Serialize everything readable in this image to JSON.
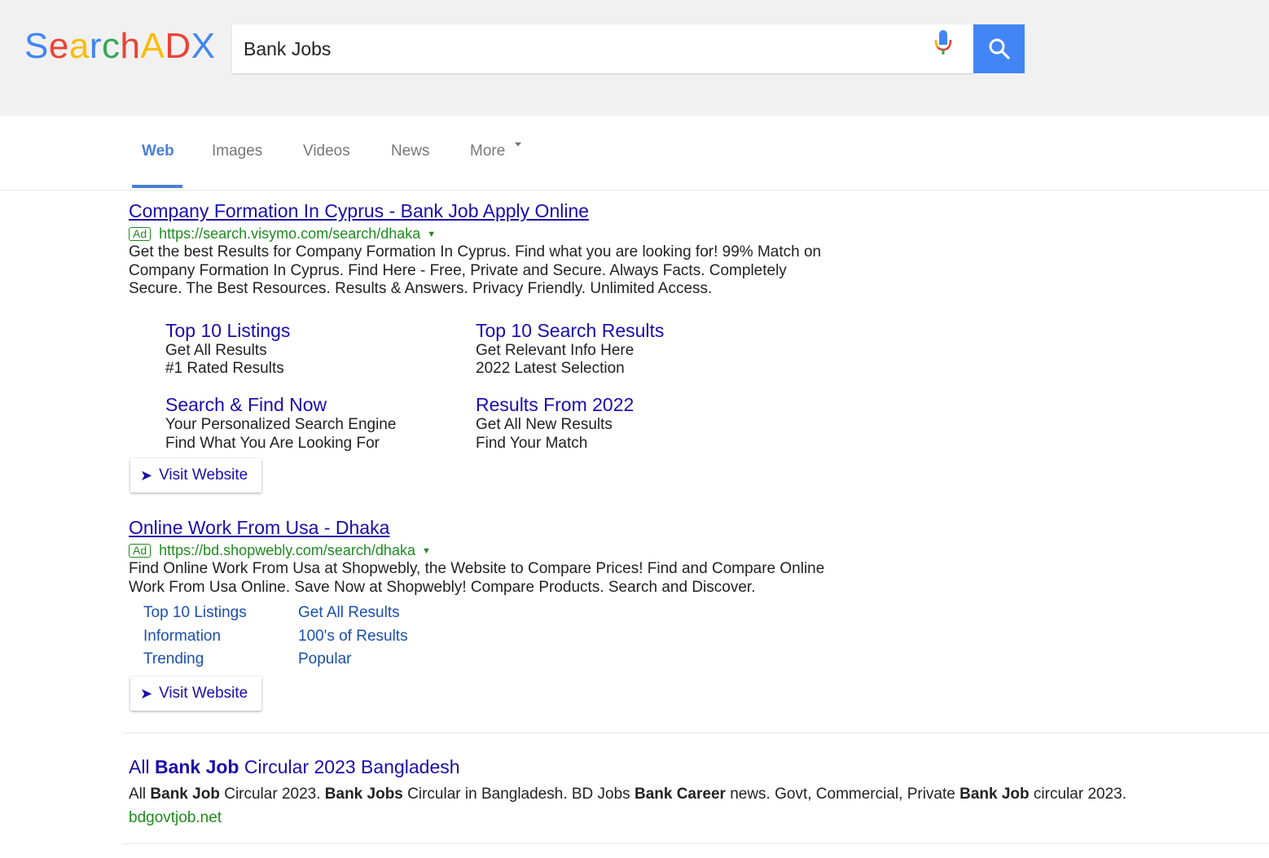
{
  "logo": {
    "letters": [
      "S",
      "e",
      "a",
      "r",
      "c",
      "h",
      "A",
      "D",
      "X"
    ],
    "colors": [
      "#4285f4",
      "#ea4335",
      "#fbbc05",
      "#4285f4",
      "#34a853",
      "#ea4335",
      "#fbbc05",
      "#ea4335",
      "#4285f4"
    ]
  },
  "search": {
    "query": "Bank Jobs",
    "icon": "search-icon",
    "mic_icon": "mic-icon",
    "button_color": "#4285f4"
  },
  "tabs": [
    {
      "label": "Web",
      "active": true
    },
    {
      "label": "Images",
      "active": false
    },
    {
      "label": "Videos",
      "active": false
    },
    {
      "label": "News",
      "active": false
    },
    {
      "label": "More",
      "active": false
    }
  ],
  "ads": [
    {
      "title": "Company Formation In Cyprus - Bank Job Apply Online",
      "badge": "Ad",
      "url": "https://search.visymo.com/search/dhaka",
      "desc_lines": [
        "Get the best Results for Company Formation In Cyprus. Find what you are looking for! 99% Match on",
        "Company Formation In Cyprus. Find Here - Free, Private and Secure. Always Facts. Completely",
        "Secure. The Best Resources. Results & Answers. Privacy Friendly. Unlimited Access."
      ],
      "sitelinks": [
        {
          "title": "Top 10 Listings",
          "line1": "Get All Results",
          "line2": "#1 Rated Results"
        },
        {
          "title": "Top 10 Search Results",
          "line1": "Get Relevant Info Here",
          "line2": "2022 Latest Selection"
        },
        {
          "title": "Search & Find Now",
          "line1": "Your Personalized Search Engine",
          "line2": "Find What You Are Looking For"
        },
        {
          "title": "Results From 2022",
          "line1": "Get All New Results",
          "line2": "Find Your Match"
        }
      ],
      "visit_label": "Visit Website"
    },
    {
      "title": "Online Work From Usa - Dhaka",
      "badge": "Ad",
      "url": "https://bd.shopwebly.com/search/dhaka",
      "desc_lines": [
        "Find Online Work From Usa at Shopwebly, the Website to Compare Prices! Find and Compare Online",
        "Work From Usa Online. Save Now at Shopwebly! Compare Products. Search and Discover."
      ],
      "links_col1": [
        "Top 10 Listings",
        "Information",
        "Trending"
      ],
      "links_col2": [
        "Get All Results",
        "100's of Results",
        "Popular"
      ],
      "visit_label": "Visit Website"
    }
  ],
  "organic": {
    "title_parts": [
      "All ",
      "Bank Job",
      " Circular 2023 Bangladesh"
    ],
    "desc_parts": [
      "All ",
      "Bank Job",
      " Circular 2023. ",
      "Bank Jobs",
      " Circular in Bangladesh. BD Jobs ",
      "Bank Career",
      " news. Govt, Commercial, Private ",
      "Bank Job",
      " circular 2023."
    ],
    "url": "bdgovtjob.net"
  }
}
